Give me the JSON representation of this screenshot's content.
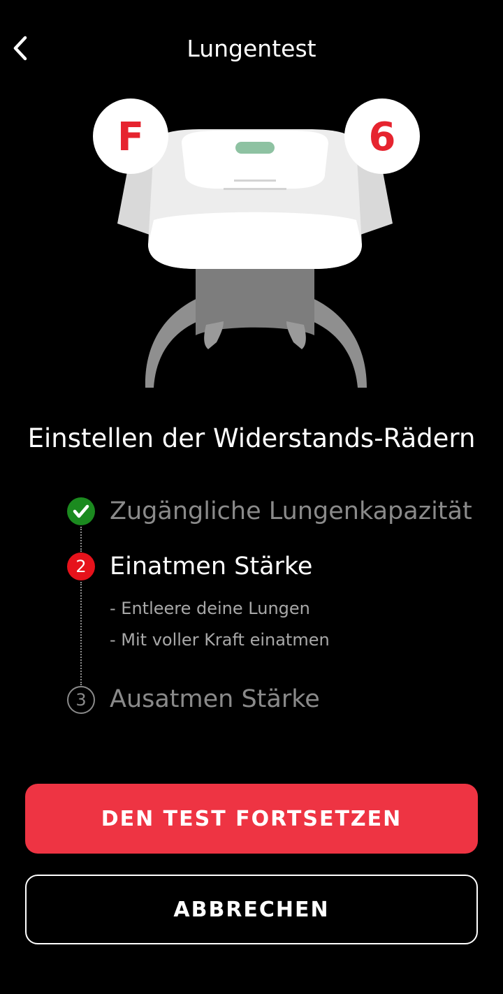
{
  "header": {
    "title": "Lungentest",
    "back_icon": "chevron-left-icon"
  },
  "illustration": {
    "left_badge": "F",
    "right_badge": "6",
    "badge_color": "#e6242f"
  },
  "section_title": "Einstellen der Widerstands-Rädern",
  "steps": [
    {
      "status": "done",
      "icon": "check-icon",
      "label": "Zugängliche Lungenkapazität"
    },
    {
      "status": "active",
      "number": "2",
      "label": "Einatmen Stärke",
      "substeps": [
        "- Entleere deine Lungen",
        "- Mit voller Kraft einatmen"
      ]
    },
    {
      "status": "pending",
      "number": "3",
      "label": "Ausatmen Stärke"
    }
  ],
  "buttons": {
    "primary": "DEN TEST FORTSETZEN",
    "secondary": "ABBRECHEN"
  },
  "colors": {
    "accent": "#ee3443",
    "done": "#1b8a1f",
    "active": "#e6121b",
    "background": "#000000"
  }
}
